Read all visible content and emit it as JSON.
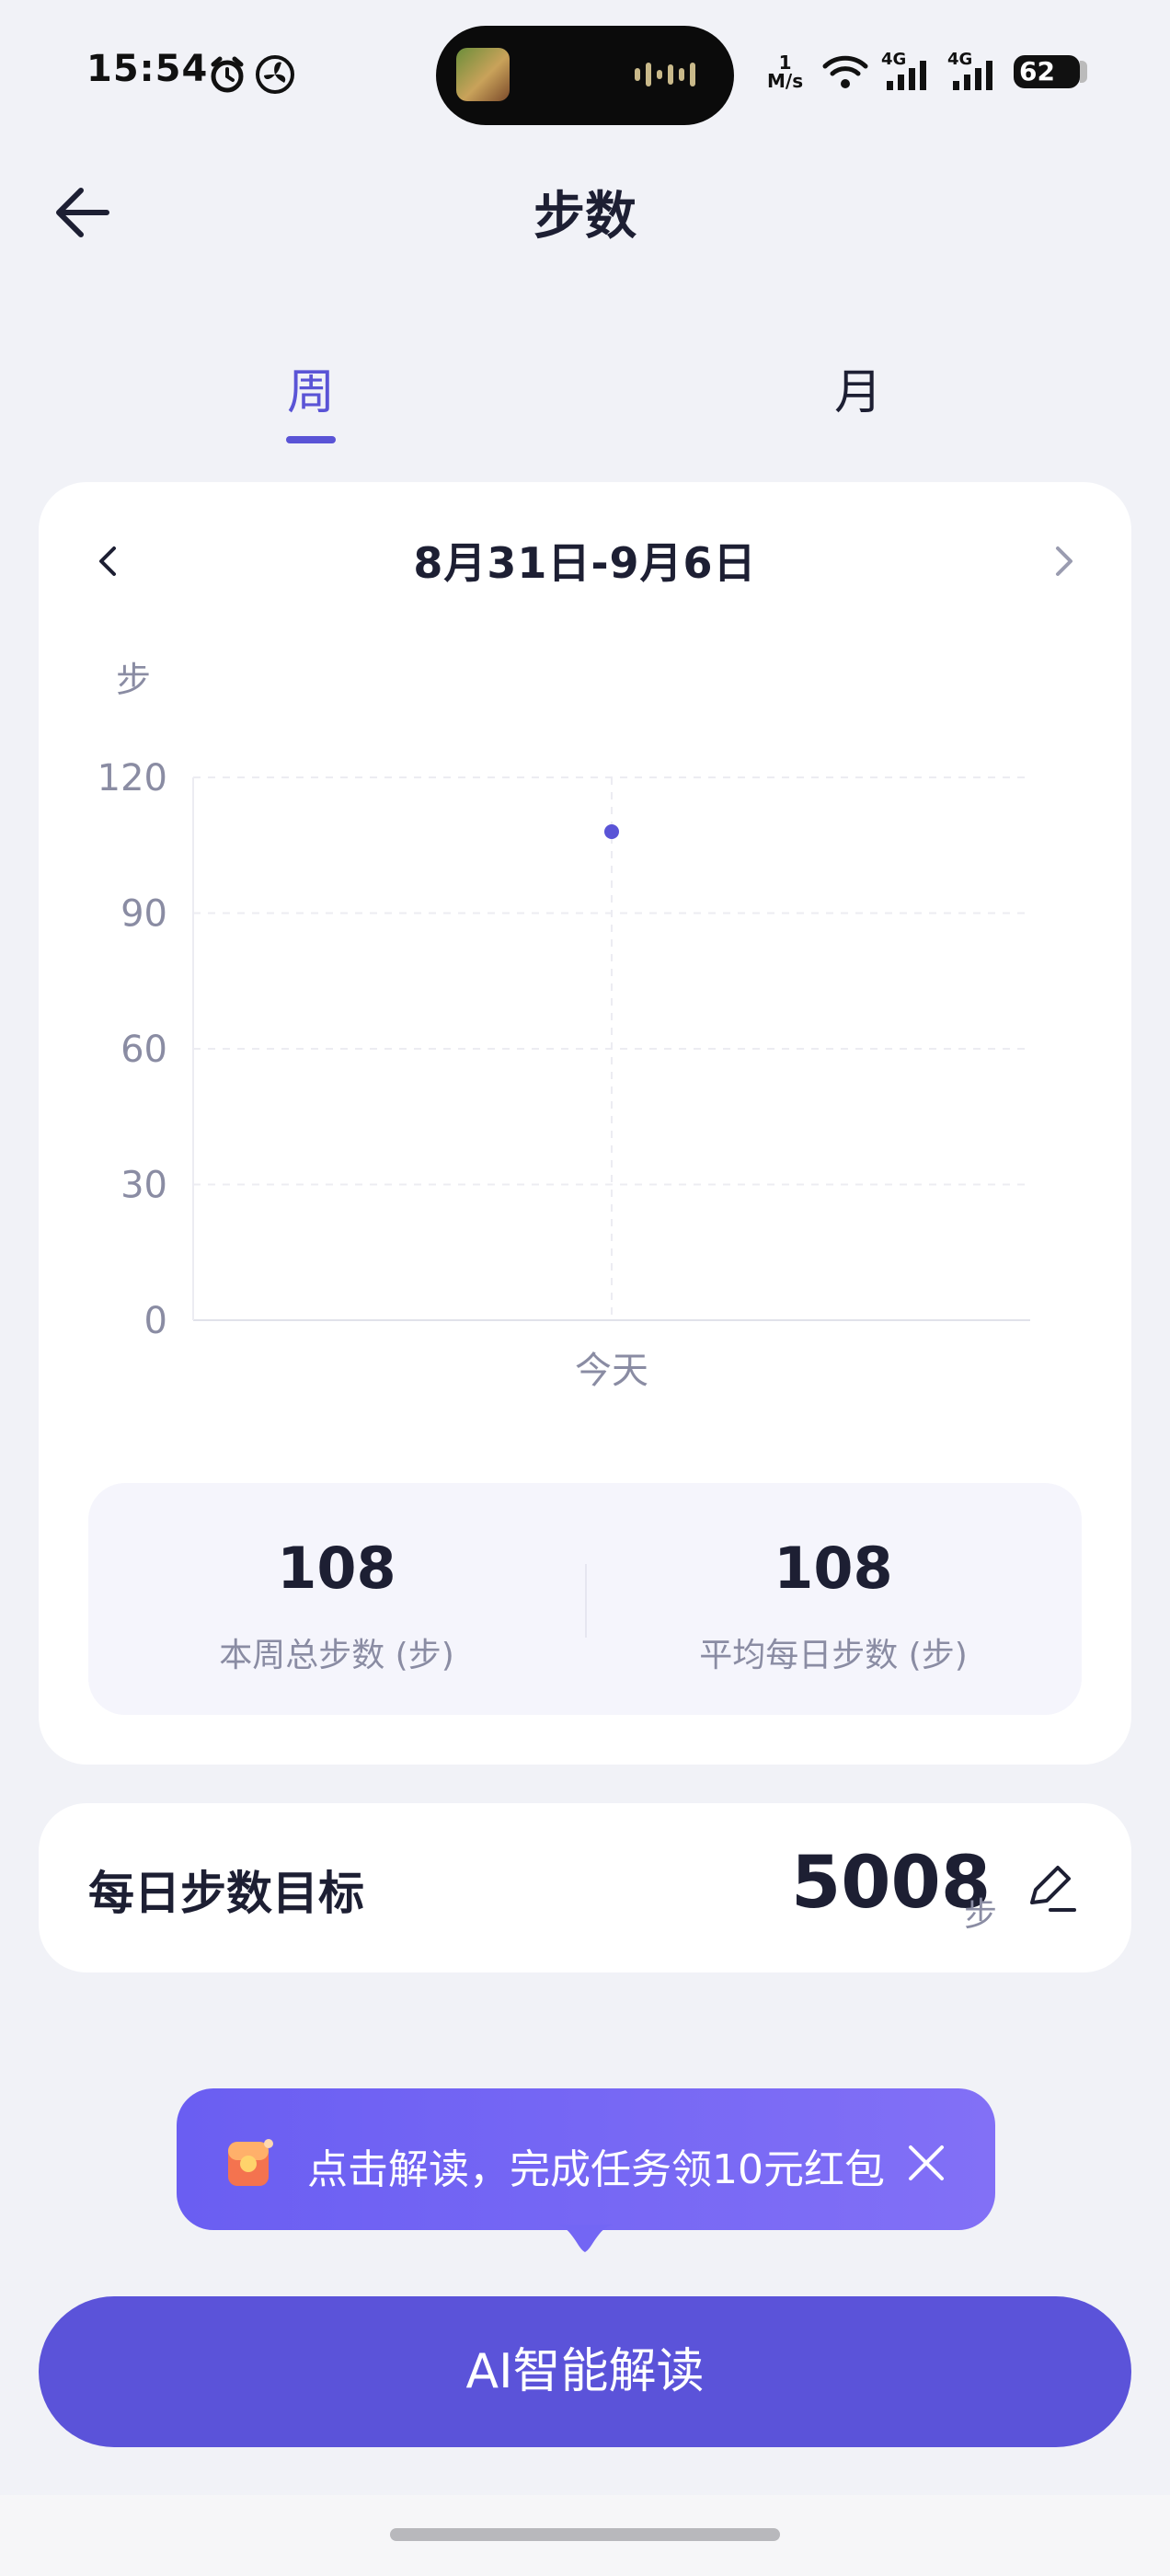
{
  "status_bar": {
    "time": "15:54",
    "netspeed_value": "1",
    "netspeed_unit": "M/s",
    "signal1_label": "4G",
    "signal2_label": "4G",
    "battery": "62",
    "icons": [
      "alarm-icon",
      "fan-icon",
      "music-wave-icon",
      "wifi-icon",
      "cell-signal-icon",
      "battery-icon"
    ]
  },
  "header": {
    "title": "步数"
  },
  "tabs": [
    {
      "label": "周",
      "active": true
    },
    {
      "label": "月",
      "active": false
    }
  ],
  "date_nav": {
    "range": "8月31日-9月6日"
  },
  "chart_data": {
    "type": "scatter",
    "ylabel": "步",
    "y_ticks": [
      "120",
      "90",
      "60",
      "30",
      "0"
    ],
    "ylim": [
      0,
      120
    ],
    "categories": [
      "今天"
    ],
    "values": [
      108
    ],
    "grid": true,
    "point_color": "#5a54d6"
  },
  "summary": {
    "total_value": "108",
    "total_label": "本周总步数 (步)",
    "avg_value": "108",
    "avg_label": "平均每日步数 (步)"
  },
  "goal": {
    "label": "每日步数目标",
    "value": "5008",
    "unit": "步"
  },
  "promo": {
    "text": "点击解读，完成任务领10元红包"
  },
  "ai_button": {
    "label": "AI智能解读"
  },
  "colors": {
    "accent": "#5a54d6",
    "background": "#f1f2f7"
  }
}
